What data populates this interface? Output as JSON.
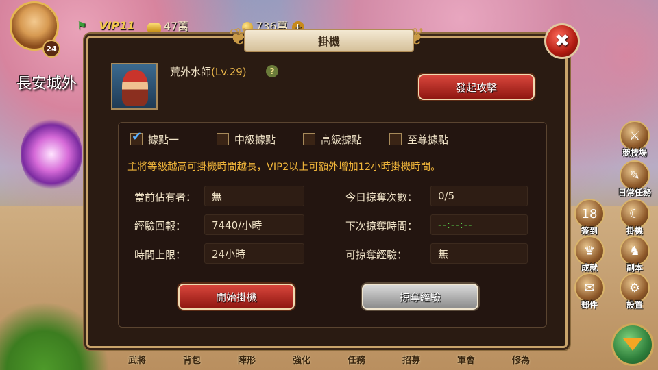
{
  "player": {
    "level": "24",
    "location": "長安城外"
  },
  "topbar": {
    "vip": "VIP11",
    "gold": "47萬",
    "coins": "736萬",
    "plus": "+"
  },
  "dialog": {
    "title": "掛機",
    "close": "✖",
    "hero_name": "荒外水師",
    "hero_level": "(Lv.29)",
    "help": "?",
    "attack_button": "發起攻擊",
    "tabs": [
      {
        "label": "據點一",
        "checked": true
      },
      {
        "label": "中級據點",
        "checked": false
      },
      {
        "label": "高級據點",
        "checked": false
      },
      {
        "label": "至尊據點",
        "checked": false
      }
    ],
    "notice": "主將等級越高可掛機時間越長，VIP2以上可額外增加12小時掛機時間。",
    "fields": {
      "occupant_label": "當前佔有者：",
      "occupant_value": "無",
      "exp_label": "經驗回報：",
      "exp_value": "7440/小時",
      "limit_label": "時間上限：",
      "limit_value": "24小時",
      "raids_label": "今日掠奪次數：",
      "raids_value": "0/5",
      "next_raid_label": "下次掠奪時間：",
      "next_raid_value": "--:--:--",
      "raidable_label": "可掠奪經驗：",
      "raidable_value": "無"
    },
    "start_button": "開始掛機",
    "plunder_button": "掠奪經驗"
  },
  "side_icons": [
    {
      "label": "競技場",
      "icon": "arena-icon"
    },
    {
      "label": "日常任務",
      "icon": "daily-task-icon"
    },
    {
      "label": "簽到",
      "icon": "calendar-icon",
      "badge": "18"
    },
    {
      "label": "掛機",
      "icon": "idle-icon"
    },
    {
      "label": "成就",
      "icon": "trophy-icon"
    },
    {
      "label": "副本",
      "icon": "dungeon-icon"
    },
    {
      "label": "郵件",
      "icon": "mail-icon"
    },
    {
      "label": "設置",
      "icon": "gear-icon"
    }
  ],
  "bottom_menu": [
    "武將",
    "背包",
    "陣形",
    "強化",
    "任務",
    "招募",
    "軍會",
    "修為"
  ],
  "colors": {
    "notice": "#f0b53a",
    "timer": "#58d24a",
    "accent_red": "#b01a10"
  }
}
